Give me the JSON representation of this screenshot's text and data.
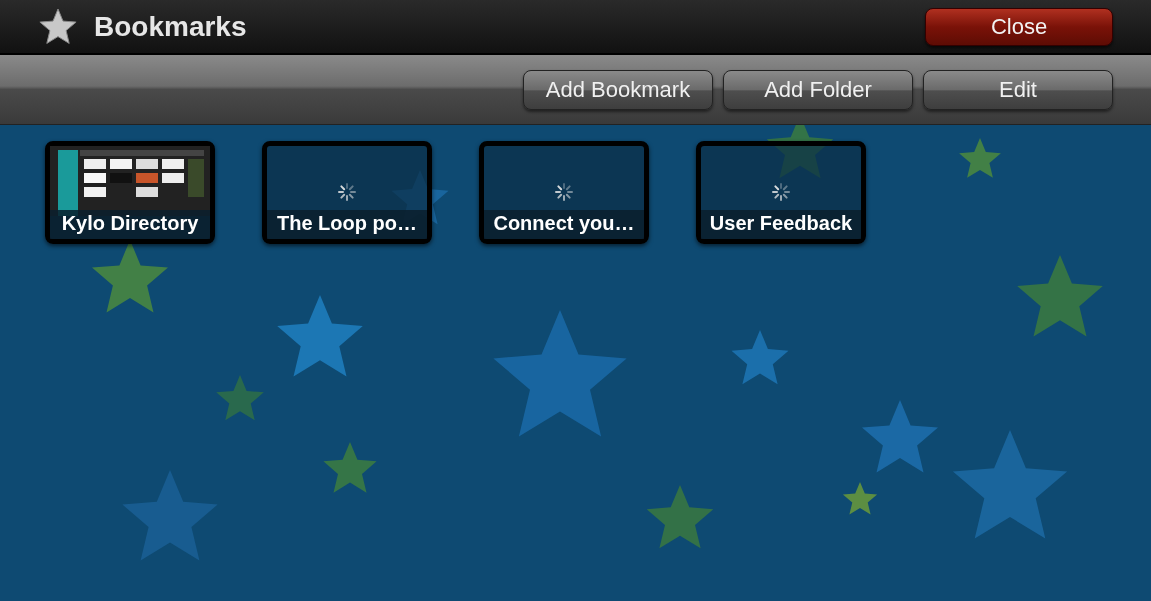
{
  "window": {
    "title": "Bookmarks"
  },
  "close_button": "Close",
  "toolbar": {
    "buttons": [
      "Add Bookmark",
      "Add Folder",
      "Edit"
    ]
  },
  "bookmarks": [
    {
      "title": "Kylo Directory",
      "kind": "picture"
    },
    {
      "title": "The Loop po…",
      "kind": "loading"
    },
    {
      "title": "Connect you…",
      "kind": "loading"
    },
    {
      "title": "User Feedback",
      "kind": "loading"
    }
  ]
}
